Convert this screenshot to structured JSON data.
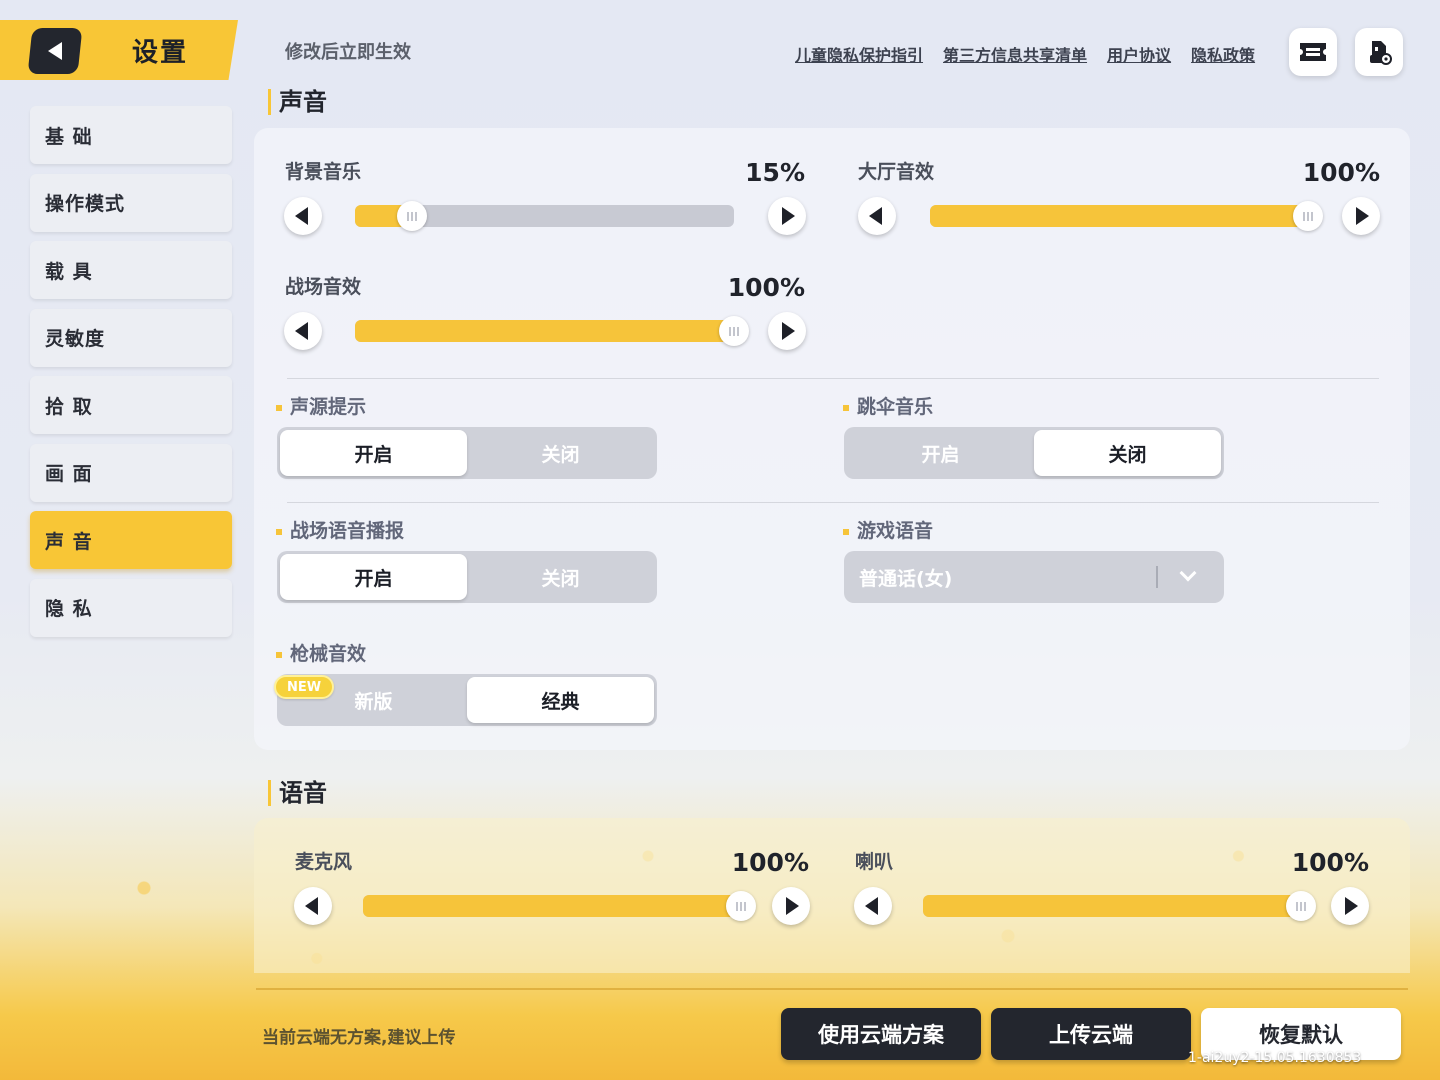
{
  "header": {
    "title": "设置",
    "subtitle": "修改后立即生效",
    "links": [
      "儿童隐私保护指引",
      "第三方信息共享清单",
      "用户协议",
      "隐私政策"
    ]
  },
  "sidebar": {
    "items": [
      {
        "label": "基 础"
      },
      {
        "label": "操作模式"
      },
      {
        "label": "载 具"
      },
      {
        "label": "灵敏度"
      },
      {
        "label": "拾 取"
      },
      {
        "label": "画 面"
      },
      {
        "label": "声 音",
        "active": true
      },
      {
        "label": "隐 私"
      }
    ]
  },
  "sound": {
    "title": "声音",
    "sliders": {
      "bgm": {
        "label": "背景音乐",
        "value": "15%",
        "level": 15
      },
      "lobby": {
        "label": "大厅音效",
        "value": "100%",
        "level": 100
      },
      "battle": {
        "label": "战场音效",
        "value": "100%",
        "level": 100
      }
    },
    "toggles": {
      "source_hint": {
        "label": "声源提示",
        "options": [
          "开启",
          "关闭"
        ],
        "selected": 0
      },
      "parachute_music": {
        "label": "跳伞音乐",
        "options": [
          "开启",
          "关闭"
        ],
        "selected": 1
      },
      "battle_voice": {
        "label": "战场语音播报",
        "options": [
          "开启",
          "关闭"
        ],
        "selected": 0
      },
      "gun_sound": {
        "label": "枪械音效",
        "options": [
          "新版",
          "经典"
        ],
        "selected": 1,
        "badge": "NEW"
      }
    },
    "game_voice": {
      "label": "游戏语音",
      "value": "普通话(女)"
    }
  },
  "voice": {
    "title": "语音",
    "sliders": {
      "mic": {
        "label": "麦克风",
        "value": "100%",
        "level": 100
      },
      "speaker": {
        "label": "喇叭",
        "value": "100%",
        "level": 100
      }
    }
  },
  "footer": {
    "note": "当前云端无方案,建议上传",
    "use_cloud": "使用云端方案",
    "upload_cloud": "上传云端",
    "restore_default": "恢复默认",
    "version": "1-ai2uy2-15.05.1630853"
  },
  "colors": {
    "accent": "#f8c636",
    "dark": "#23262e",
    "track": "#c8cad3"
  }
}
